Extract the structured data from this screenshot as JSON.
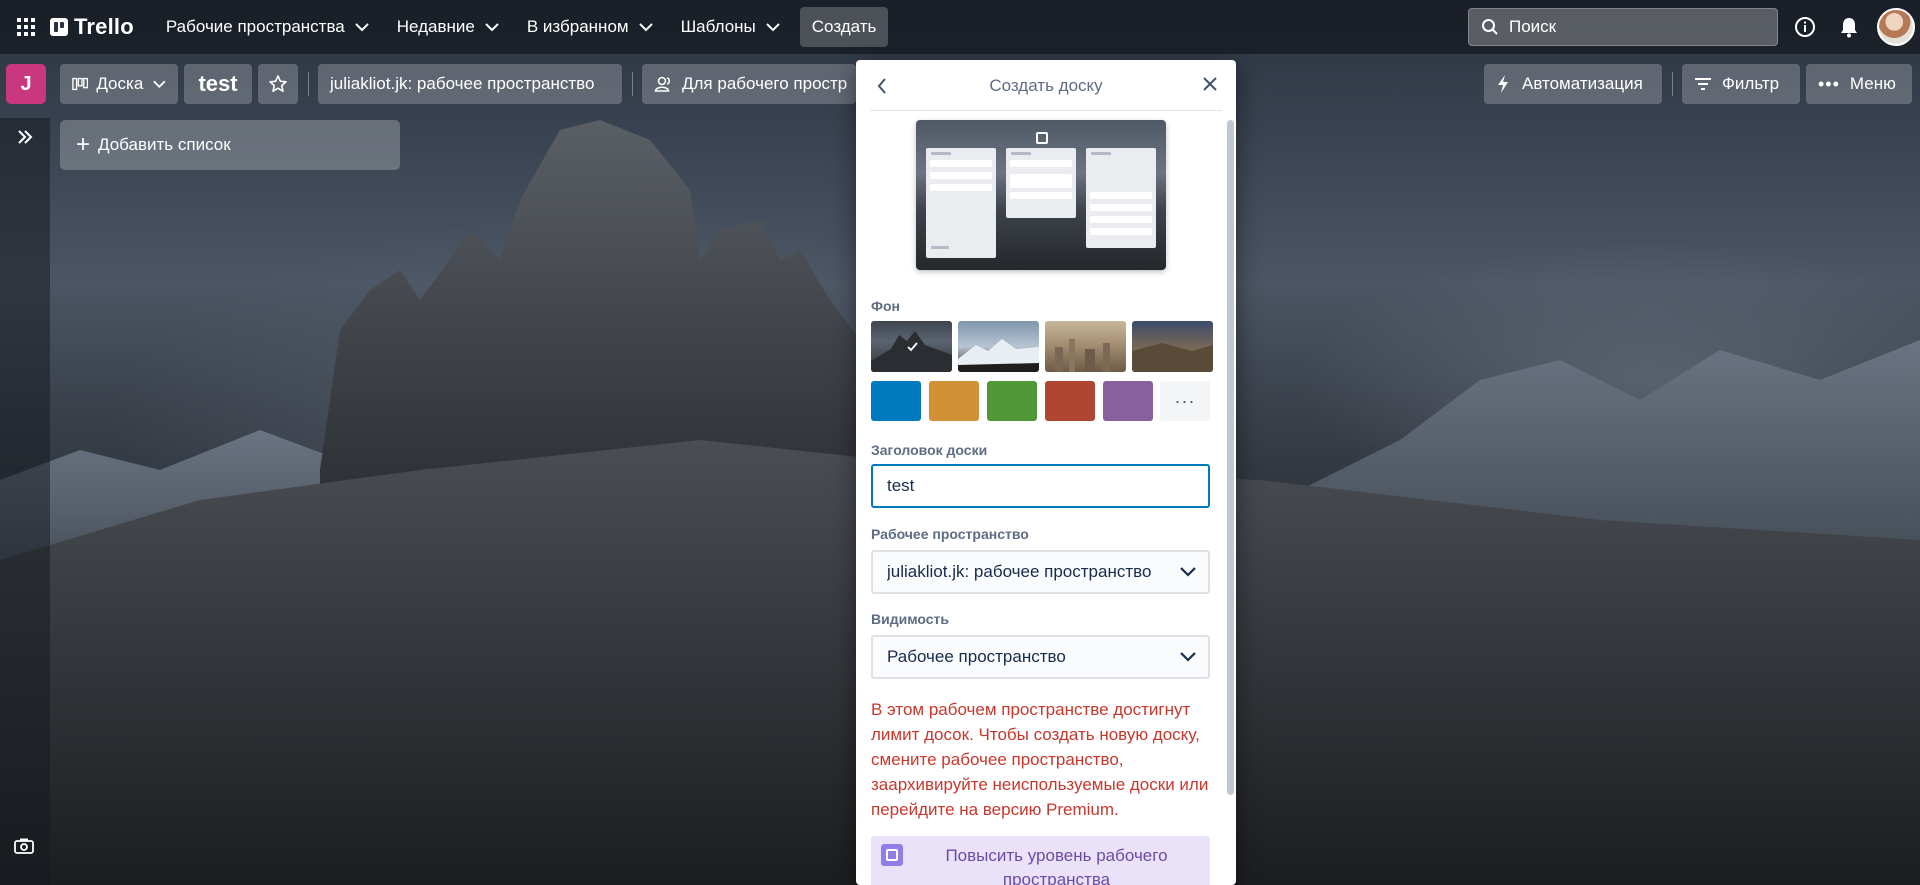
{
  "app": {
    "logo_text": "Trello",
    "nav": [
      {
        "label": "Рабочие пространства"
      },
      {
        "label": "Недавние"
      },
      {
        "label": "В избранном"
      },
      {
        "label": "Шаблоны"
      }
    ],
    "create_label": "Создать",
    "search_placeholder": "Поиск"
  },
  "board": {
    "workspace_badge": "J",
    "view_label": "Доска",
    "title": "test",
    "workspace_name": "juliakliot.jk: рабочее пространство",
    "visibility_label": "Для рабочего простр",
    "automation_label": "Автоматизация",
    "filter_label": "Фильтр",
    "menu_label": "Меню",
    "add_list_label": "Добавить список"
  },
  "popover": {
    "title": "Создать доску",
    "background_label": "Фон",
    "backgrounds": [
      {
        "name": "dolomites",
        "selected": true
      },
      {
        "name": "snow-mountains",
        "selected": false
      },
      {
        "name": "city",
        "selected": false
      },
      {
        "name": "valley",
        "selected": false
      }
    ],
    "colors": [
      "#0079bf",
      "#d29034",
      "#519839",
      "#b04632",
      "#89609e"
    ],
    "more_label": "···",
    "title_field_label": "Заголовок доски",
    "title_field_value": "test",
    "workspace_label": "Рабочее пространство",
    "workspace_value": "juliakliot.jk: рабочее пространство",
    "visibility_label": "Видимость",
    "visibility_value": "Рабочее пространство",
    "warning": "В этом рабочем пространстве достигнут лимит досок. Чтобы создать новую доску, смените рабочее пространство, заархивируйте неиспользуемые доски или перейдите на версию Premium.",
    "upgrade_label": "Повысить уровень рабочего пространства"
  },
  "colors": {
    "accent_blue": "#0079bf",
    "workspace_badge": "#c9377f",
    "warning_red": "#c9372c",
    "upgrade_bg": "#eae2f8"
  }
}
